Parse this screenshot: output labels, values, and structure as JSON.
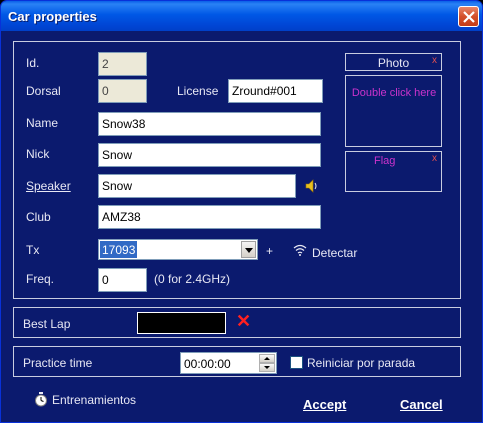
{
  "window": {
    "title": "Car properties"
  },
  "form": {
    "id": {
      "label": "Id.",
      "value": "2"
    },
    "dorsal": {
      "label": "Dorsal",
      "value": "0"
    },
    "license": {
      "label": "License",
      "value": "Zround#001"
    },
    "name": {
      "label": "Name",
      "value": "Snow38"
    },
    "nick": {
      "label": "Nick",
      "value": "Snow"
    },
    "speaker": {
      "label": "Speaker",
      "value": "Snow"
    },
    "club": {
      "label": "Club",
      "value": "AMZ38"
    },
    "tx": {
      "label": "Tx",
      "value": "17093",
      "plus": "+",
      "detect": "Detectar"
    },
    "freq": {
      "label": "Freq.",
      "value": "0",
      "hint": "(0 for 2.4GHz)"
    }
  },
  "photo": {
    "title": "Photo",
    "hint": "Double click here",
    "close": "x"
  },
  "flag": {
    "title": "Flag",
    "close": "x"
  },
  "best_lap": {
    "label": "Best Lap",
    "clear": "✕"
  },
  "practice": {
    "label": "Practice time",
    "value": "00:00:00",
    "checkbox_label": "Reiniciar por parada",
    "checked": false
  },
  "footer": {
    "trainings": "Entrenamientos",
    "accept": "Accept",
    "cancel": "Cancel"
  }
}
